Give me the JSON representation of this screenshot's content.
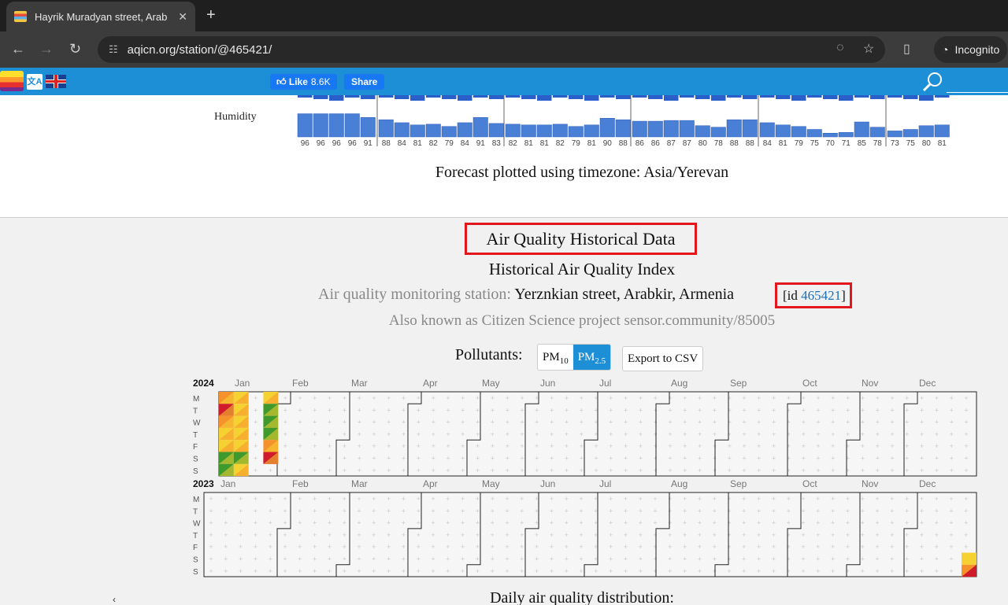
{
  "browser": {
    "tab_title": "Hayrik Muradyan street, Arab",
    "new_tab": "+",
    "url": "aqicn.org/station/@465421/",
    "incognito_label": "Incognito"
  },
  "header": {
    "fb_like_label": "Like",
    "fb_like_count": "8.6K",
    "fb_share_label": "Share"
  },
  "forecast": {
    "humidity_label": "Humidity",
    "humidity_days": [
      [
        96,
        96,
        96,
        96,
        91
      ],
      [
        88,
        84,
        81,
        82,
        79,
        84,
        91,
        83
      ],
      [
        82,
        81,
        81,
        82,
        79,
        81,
        90,
        88
      ],
      [
        86,
        86,
        87,
        87,
        80,
        78,
        88,
        88
      ],
      [
        84,
        81,
        79,
        75,
        70,
        71,
        85,
        78
      ],
      [
        73,
        75,
        80,
        81
      ]
    ],
    "timezone_note": "Forecast plotted using timezone: Asia/Yerevan"
  },
  "historical": {
    "title": "Air Quality Historical Data",
    "subtitle": "Historical Air Quality Index",
    "station_prefix": "Air quality monitoring station:",
    "station_name": "Yerznkian street, Arabkir, Armenia",
    "id_prefix": "[id ",
    "id_value": "465421",
    "id_suffix": "]",
    "aka": "Also known as Citizen Science project sensor.community/85005",
    "pollutants_label": "Pollutants:",
    "pm10": "PM",
    "pm10_sub": "10",
    "pm25": "PM",
    "pm25_sub": "2.5",
    "export_label": "Export to CSV",
    "daily_title": "Daily air quality distribution:"
  },
  "calendar": {
    "day_labels": [
      "M",
      "T",
      "W",
      "T",
      "F",
      "S",
      "S"
    ],
    "months": [
      "Jan",
      "Feb",
      "Mar",
      "Apr",
      "May",
      "Jun",
      "Jul",
      "Aug",
      "Sep",
      "Oct",
      "Nov",
      "Dec"
    ],
    "years": [
      "2024",
      "2023"
    ],
    "colors": {
      "good": "#3f9a2e",
      "moderate": "#f5d231",
      "sensitive": "#f5922b",
      "unhealthy": "#cf1b2b"
    }
  }
}
